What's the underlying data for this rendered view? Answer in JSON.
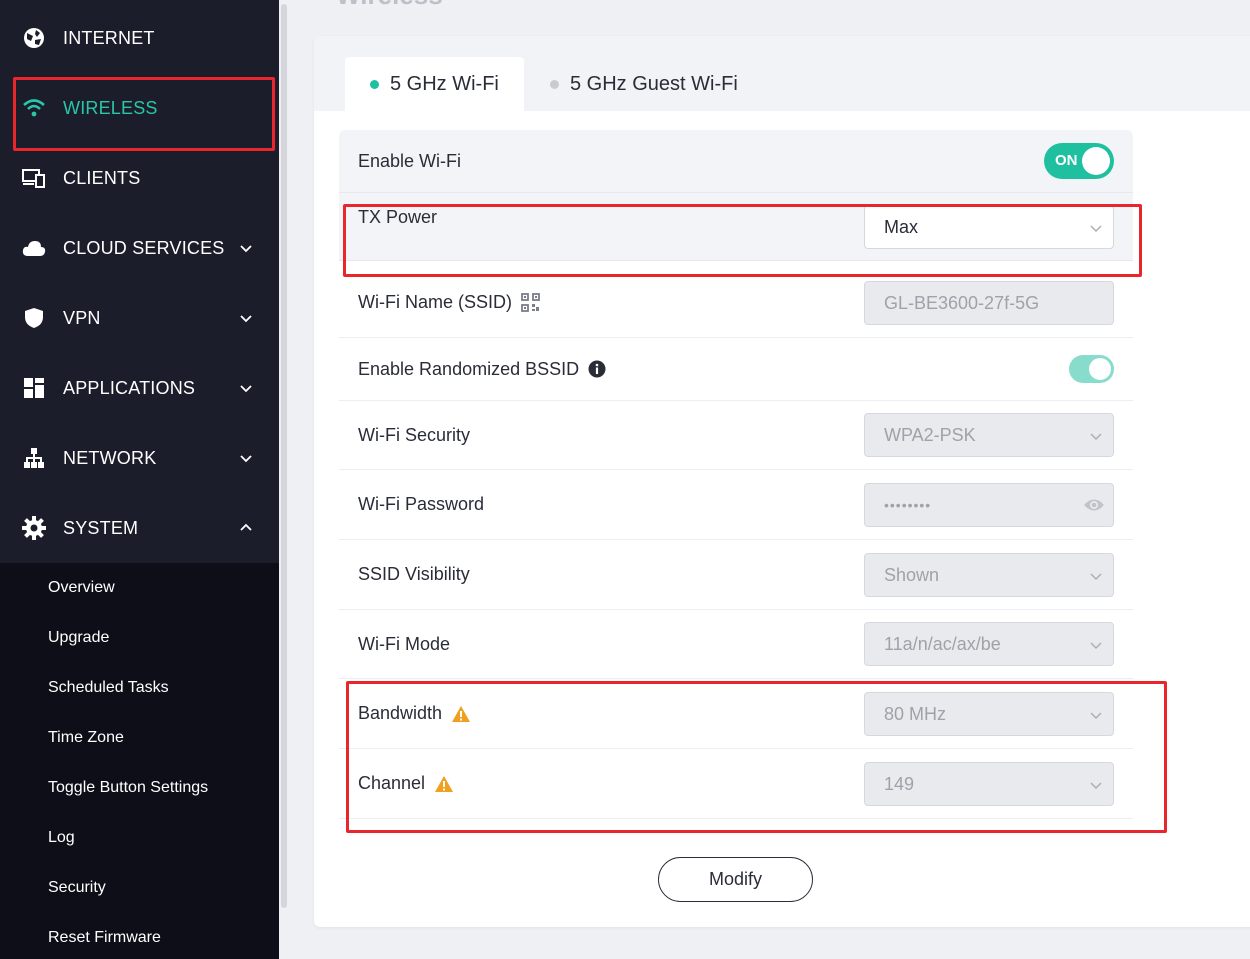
{
  "page": {
    "title": "Wireless"
  },
  "sidebar": {
    "items": [
      {
        "label": "INTERNET",
        "icon": "globe-icon"
      },
      {
        "label": "WIRELESS",
        "icon": "wifi-icon",
        "active": true
      },
      {
        "label": "CLIENTS",
        "icon": "devices-icon"
      },
      {
        "label": "CLOUD SERVICES",
        "icon": "cloud-icon",
        "expandable": true
      },
      {
        "label": "VPN",
        "icon": "shield-icon",
        "expandable": true
      },
      {
        "label": "APPLICATIONS",
        "icon": "apps-grid-icon",
        "expandable": true
      },
      {
        "label": "NETWORK",
        "icon": "network-tree-icon",
        "expandable": true
      },
      {
        "label": "SYSTEM",
        "icon": "gear-icon",
        "expanded": true
      }
    ],
    "system_submenu": [
      "Overview",
      "Upgrade",
      "Scheduled Tasks",
      "Time Zone",
      "Toggle Button Settings",
      "Log",
      "Security",
      "Reset Firmware"
    ]
  },
  "tabs": [
    {
      "label": "5 GHz Wi-Fi",
      "active": true
    },
    {
      "label": "5 GHz Guest Wi-Fi",
      "active": false
    }
  ],
  "settings": {
    "enable_wifi": {
      "label": "Enable Wi-Fi",
      "state": "ON"
    },
    "tx_power": {
      "label": "TX Power",
      "value": "Max"
    },
    "ssid": {
      "label": "Wi-Fi Name (SSID)",
      "value": "GL-BE3600-27f-5G"
    },
    "random_bssid": {
      "label": "Enable Randomized BSSID"
    },
    "security": {
      "label": "Wi-Fi Security",
      "value": "WPA2-PSK"
    },
    "password": {
      "label": "Wi-Fi Password",
      "value": "••••••••"
    },
    "ssid_visibility": {
      "label": "SSID Visibility",
      "value": "Shown"
    },
    "wifi_mode": {
      "label": "Wi-Fi Mode",
      "value": "11a/n/ac/ax/be"
    },
    "bandwidth": {
      "label": "Bandwidth",
      "value": "80 MHz"
    },
    "channel": {
      "label": "Channel",
      "value": "149"
    }
  },
  "actions": {
    "modify_label": "Modify"
  },
  "colors": {
    "accent": "#1ec0a0",
    "sidebar_bg": "#1b1d2b",
    "highlight": "#e8262b",
    "warning": "#f0a020"
  }
}
